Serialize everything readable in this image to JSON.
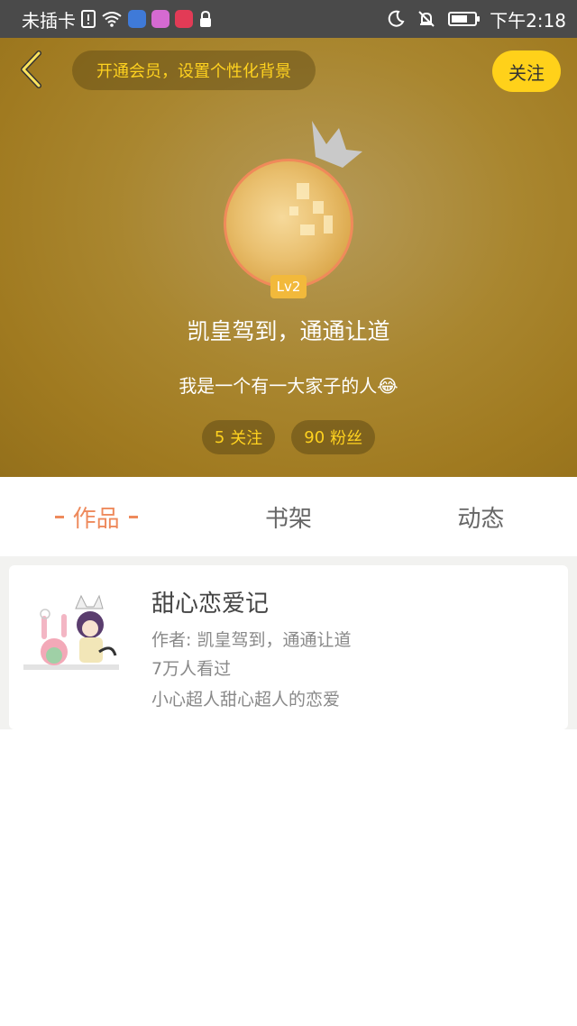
{
  "status_bar": {
    "carrier": "未插卡",
    "time": "下午2:18",
    "icons": [
      "sim-alert-icon",
      "wifi-icon",
      "baidu-app-icon",
      "app-icon",
      "app-icon",
      "lock-icon",
      "moon-icon",
      "bell-off-icon",
      "battery-icon"
    ]
  },
  "header": {
    "back_icon": "chevron-left-icon",
    "vip_banner": "开通会员，设置个性化背景",
    "follow_label": "关注",
    "level": "Lv2",
    "nickname": "凯皇驾到，通通让道",
    "bio": "我是一个有一大家子的人😂",
    "stats": [
      {
        "count": "5",
        "label": "关注"
      },
      {
        "count": "90",
        "label": "粉丝"
      }
    ]
  },
  "tabs": [
    {
      "label": "作品",
      "active": true
    },
    {
      "label": "书架",
      "active": false
    },
    {
      "label": "动态",
      "active": false
    }
  ],
  "works": [
    {
      "title": "甜心恋爱记",
      "author": "作者: 凯皇驾到，通通让道",
      "views": "7万人看过",
      "summary": "小心超人甜心超人的恋爱"
    }
  ],
  "colors": {
    "status_bar": "#4a4a4a",
    "header_bg": "#a9862f",
    "accent_yellow": "#ffd21f",
    "follow_button": "#ffd11a",
    "active_tab": "#ee8a5c",
    "level_badge": "#f2b93b"
  }
}
